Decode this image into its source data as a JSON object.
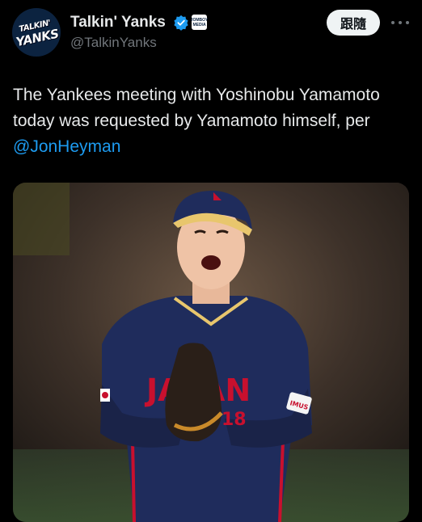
{
  "account": {
    "display_name": "Talkin' Yanks",
    "handle": "@TalkinYanks",
    "avatar_text_line1": "TALKIN'",
    "avatar_text_line2": "YANKS",
    "affiliate_badge_text": "JOMBOY MEDIA"
  },
  "actions": {
    "follow_label": "跟隨"
  },
  "tweet": {
    "text_before_mention": "The Yankees meeting with Yoshinobu Yamamoto today was requested by Yamamoto himself, per ",
    "mention": "@JonHeyman"
  },
  "media": {
    "jersey_text": "JAPAN",
    "jersey_number": "18",
    "sleeve_patch": "IMUS"
  },
  "colors": {
    "background": "#000000",
    "text": "#e7e9ea",
    "secondary_text": "#71767b",
    "link": "#1d9bf0",
    "verified": "#1d9bf0",
    "jersey_navy": "#1f2c5c",
    "jersey_red": "#c8102e"
  }
}
